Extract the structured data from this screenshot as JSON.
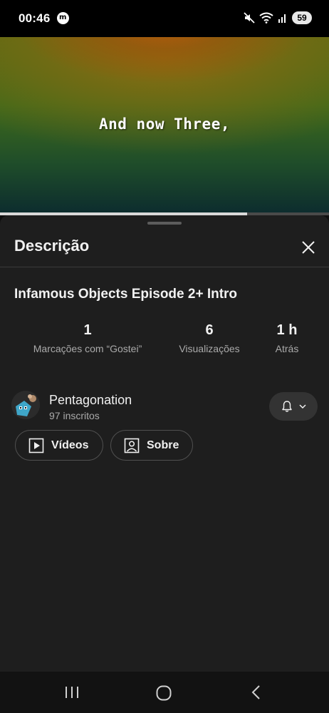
{
  "status": {
    "time": "00:46",
    "battery": "59"
  },
  "video": {
    "caption": "And now Three,",
    "progress": 0.75
  },
  "sheet": {
    "title": "Descrição",
    "video_title": "Infamous Objects Episode 2+ Intro",
    "stats": [
      {
        "value": "1",
        "label": "Marcações com “Gostei”"
      },
      {
        "value": "6",
        "label": "Visualizações"
      },
      {
        "value": "1 h",
        "label": "Atrás"
      }
    ],
    "channel": {
      "name": "Pentagonation",
      "subscribers": "97 inscritos"
    },
    "buttons": {
      "videos": "Vídeos",
      "about": "Sobre"
    }
  },
  "icons": {
    "close": "close-icon",
    "bell": "bell-icon",
    "chevron": "chevron-down-icon",
    "play": "play-square-icon",
    "person": "person-square-icon",
    "nav_recents": "recents-icon",
    "nav_home": "home-icon",
    "nav_back": "back-icon"
  },
  "colors": {
    "background": "#0f0f0f",
    "sheet": "#1e1e1e",
    "secondary_text": "#aaaaaa"
  }
}
